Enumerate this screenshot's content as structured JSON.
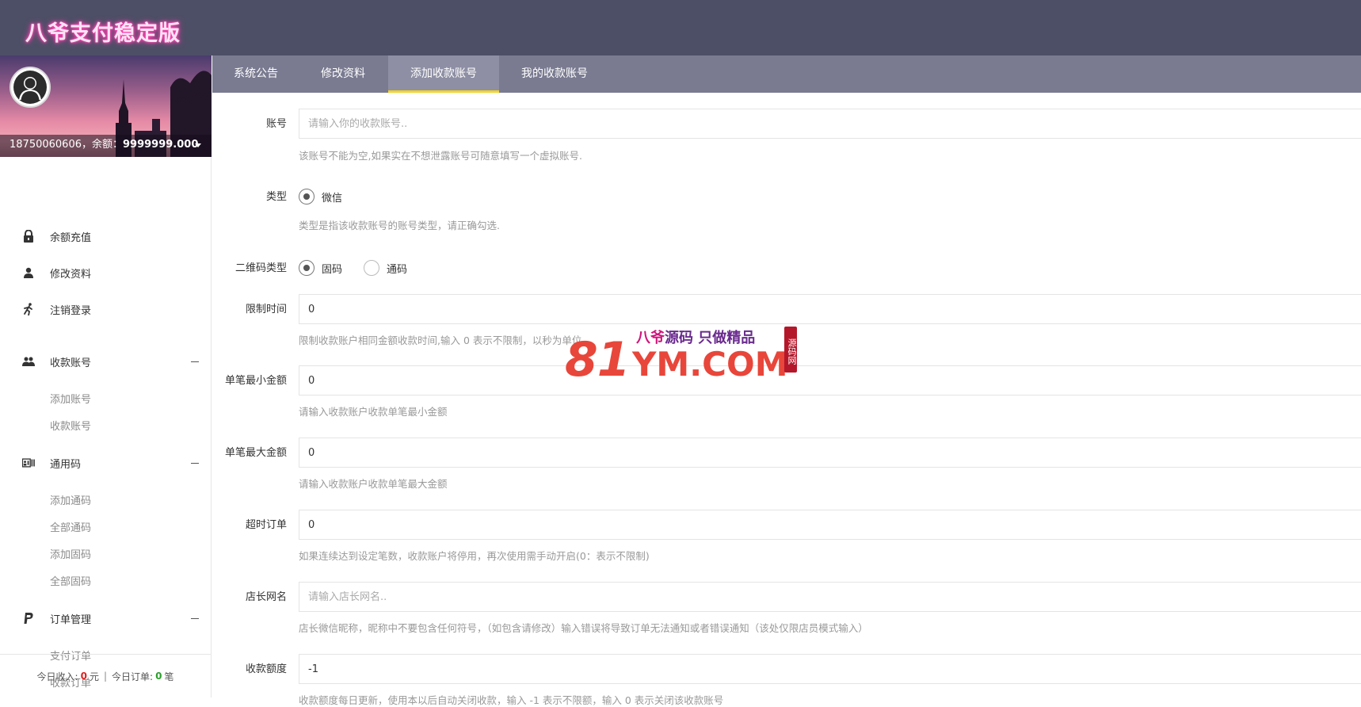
{
  "app": {
    "logo": "八爷支付稳定版"
  },
  "user": {
    "info_prefix": "18750060606，余额：",
    "balance": "9999999.000"
  },
  "sidebar": {
    "items": [
      {
        "label": "余额充值",
        "icon": "lock-icon"
      },
      {
        "label": "修改资料",
        "icon": "user-icon"
      },
      {
        "label": "注销登录",
        "icon": "runner-icon"
      }
    ],
    "groups": [
      {
        "label": "收款账号",
        "icon": "users-icon",
        "children": [
          "添加账号",
          "收款账号"
        ]
      },
      {
        "label": "通用码",
        "icon": "id-card-icon",
        "children": [
          "添加通码",
          "全部通码",
          "添加固码",
          "全部固码"
        ]
      },
      {
        "label": "订单管理",
        "icon": "paypal-icon",
        "children": [
          "支付订单",
          "收款订单"
        ]
      }
    ],
    "footer": {
      "income_label": "今日收入:",
      "income_value": "0",
      "income_unit": "元",
      "separator": "|",
      "orders_label": "今日订单:",
      "orders_value": "0",
      "orders_unit": "笔"
    }
  },
  "tabs": [
    {
      "label": "系统公告",
      "active": false
    },
    {
      "label": "修改资料",
      "active": false
    },
    {
      "label": "添加收款账号",
      "active": true
    },
    {
      "label": "我的收款账号",
      "active": false
    }
  ],
  "form": {
    "account": {
      "label": "账号",
      "placeholder": "请输入你的收款账号..",
      "value": "",
      "help": "该账号不能为空,如果实在不想泄露账号可随意填写一个虚拟账号."
    },
    "type": {
      "label": "类型",
      "options": [
        {
          "label": "微信",
          "checked": true
        }
      ],
      "help": "类型是指该收款账号的账号类型，请正确勾选."
    },
    "qr_type": {
      "label": "二维码类型",
      "options": [
        {
          "label": "固码",
          "checked": true
        },
        {
          "label": "通码",
          "checked": false
        }
      ]
    },
    "limit_time": {
      "label": "限制时间",
      "value": "0",
      "help": "限制收款账户相同金额收款时间,输入 0 表示不限制，以秒为单位"
    },
    "min_amount": {
      "label": "单笔最小金额",
      "value": "0",
      "help": "请输入收款账户收款单笔最小金额"
    },
    "max_amount": {
      "label": "单笔最大金额",
      "value": "0",
      "help": "请输入收款账户收款单笔最大金额"
    },
    "timeout_orders": {
      "label": "超时订单",
      "value": "0",
      "help": "如果连续达到设定笔数，收款账户将停用，再次使用需手动开启(0：表示不限制)"
    },
    "shop_name": {
      "label": "店长网名",
      "placeholder": "请输入店长网名..",
      "value": "",
      "help": "店长微信昵称，昵称中不要包含任何符号，（如包含请修改）输入错误将导致订单无法通知或者错误通知（该处仅限店员模式输入）"
    },
    "quota": {
      "label": "收款额度",
      "value": "-1",
      "help": "收款额度每日更新，使用本以后自动关闭收款，输入 -1 表示不限额，输入 0 表示关闭该收款账号"
    }
  },
  "watermark": {
    "number": "81",
    "domain": "YM.COM",
    "slogan_pink": "八爷",
    "slogan_rest": "源码 只做精品",
    "seal": "源码网"
  },
  "colors": {
    "topbar": "#4d4f66",
    "tabs": "#7a7b91",
    "tab_active_underline": "#f2d42d",
    "watermark_red": "#e8463a"
  }
}
